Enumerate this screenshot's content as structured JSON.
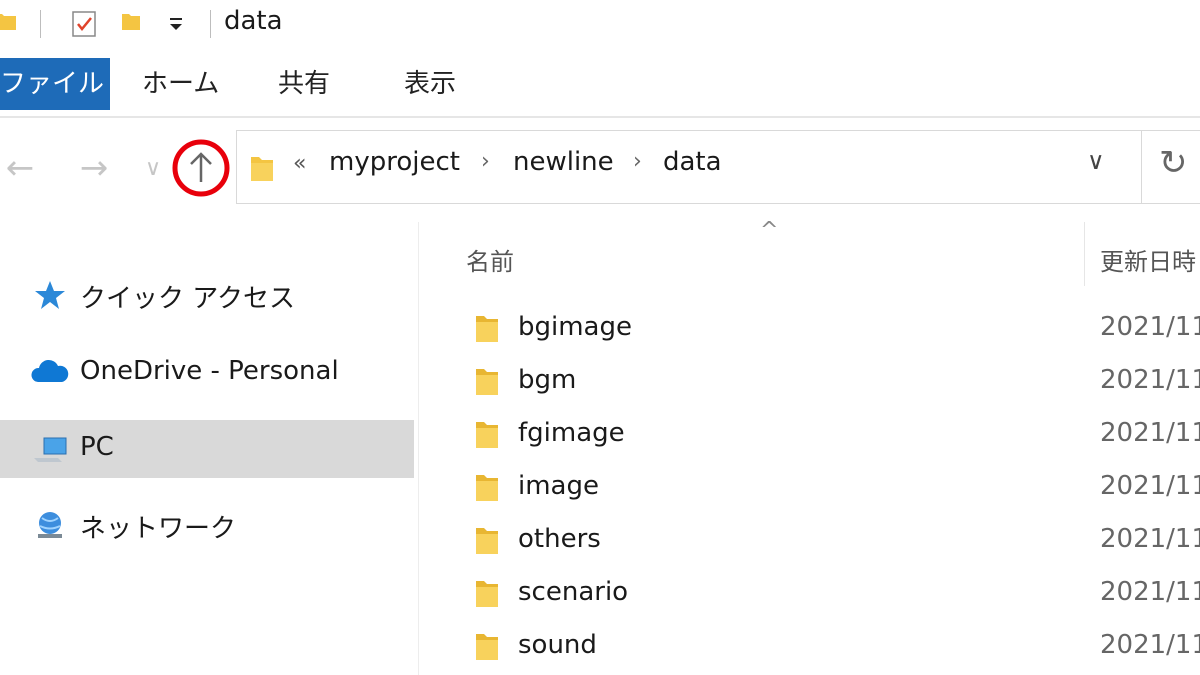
{
  "titlebar": {
    "title": "data"
  },
  "ribbon": {
    "tabs": [
      {
        "label": "ファイル"
      },
      {
        "label": "ホーム"
      },
      {
        "label": "共有"
      },
      {
        "label": "表示"
      }
    ]
  },
  "nav": {
    "back_glyph": "←",
    "forward_glyph": "→",
    "recent_glyph": "∨",
    "up_glyph": "↑",
    "up_highlight_color": "#e8000b"
  },
  "address": {
    "overflow": "«",
    "crumbs": [
      "myproject",
      "newline",
      "data"
    ],
    "separator": "›",
    "dropdown_glyph": "∨",
    "refresh_glyph": "↻"
  },
  "navpane": {
    "items": [
      {
        "label": "クイック アクセス",
        "icon": "star-icon"
      },
      {
        "label": "OneDrive - Personal",
        "icon": "cloud-icon"
      },
      {
        "label": "PC",
        "icon": "computer-icon",
        "selected": true
      },
      {
        "label": "ネットワーク",
        "icon": "network-icon"
      }
    ]
  },
  "list": {
    "sort_glyph": "^",
    "columns": {
      "name": "名前",
      "date": "更新日時"
    },
    "rows": [
      {
        "name": "bgimage",
        "date": "2021/11"
      },
      {
        "name": "bgm",
        "date": "2021/11"
      },
      {
        "name": "fgimage",
        "date": "2021/11"
      },
      {
        "name": "image",
        "date": "2021/11"
      },
      {
        "name": "others",
        "date": "2021/11"
      },
      {
        "name": "scenario",
        "date": "2021/11"
      },
      {
        "name": "sound",
        "date": "2021/11"
      }
    ]
  },
  "colors": {
    "file_tab": "#1e6bb8",
    "selected_bg": "#d9d9d9",
    "folder": "#f4c542"
  }
}
